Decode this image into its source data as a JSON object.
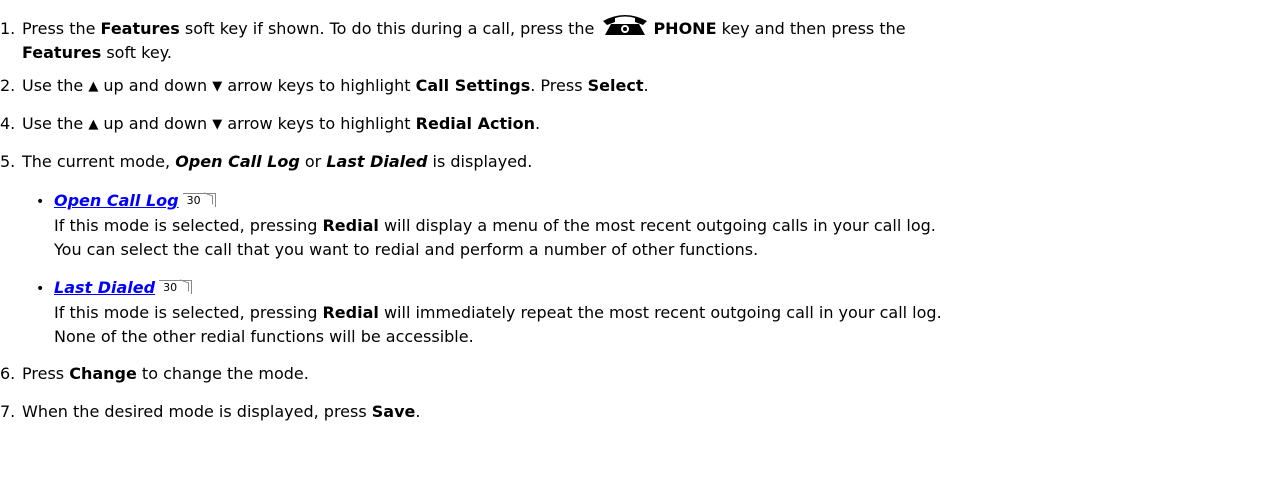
{
  "steps": [
    {
      "num": "1.",
      "t1": "Press the ",
      "b1": "Features",
      "t2": " soft key if shown. To do this during a call, press the ",
      "b2": "PHONE",
      "t3": " key and then press the",
      "b3": "Features",
      "t4": " soft key."
    },
    {
      "num": "2.",
      "t1": "Use the ",
      "t2": " up and down ",
      "t3": " arrow keys to highlight ",
      "b1": "Call Settings",
      "t4": ". Press ",
      "b2": "Select",
      "t5": "."
    },
    {
      "num": "4.",
      "t1": "Use the ",
      "t2": " up and down ",
      "t3": " arrow keys to highlight ",
      "b1": "Redial Action",
      "t4": "."
    },
    {
      "num": "5.",
      "t1": "The current mode, ",
      "bi1": "Open Call Log",
      "t2": " or ",
      "bi2": "Last Dialed",
      "t3": " is displayed."
    },
    {
      "num": "6.",
      "t1": "Press ",
      "b1": "Change",
      "t2": " to change the mode."
    },
    {
      "num": "7.",
      "t1": "When the desired mode is displayed, press ",
      "b1": "Save",
      "t2": "."
    }
  ],
  "options": [
    {
      "link": "Open Call Log",
      "ref": "30",
      "l1a": "If this mode is selected, pressing ",
      "l1b": "Redial",
      "l1c": " will display a menu of the most recent outgoing calls in your call log.",
      "l2": "You can select the call that you want to redial and perform a number of other functions."
    },
    {
      "link": "Last Dialed",
      "ref": "30",
      "l1a": "If this mode is selected, pressing ",
      "l1b": "Redial",
      "l1c": " will immediately repeat the most recent outgoing call in your call log.",
      "l2": "None of the other redial functions will be accessible."
    }
  ],
  "icons": {
    "up": "▲",
    "down": "▼",
    "phone": "phone-key-icon",
    "bullet": "•"
  }
}
